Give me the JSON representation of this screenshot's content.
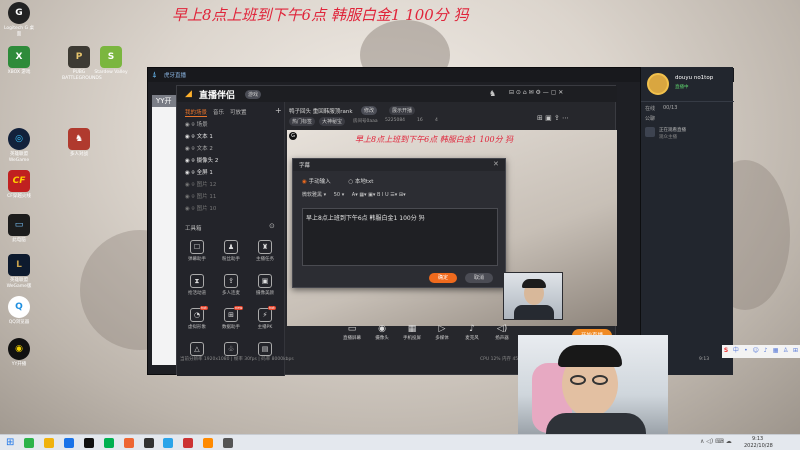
{
  "overlay_title": "早上8点上班到下午6点 韩服白金1 100分 犸",
  "desktop_icons": [
    {
      "name": "Logitech G HUB",
      "label": "Logitech G\n桌面"
    },
    {
      "name": "xbox-game",
      "label": "XBOX\n游戏"
    },
    {
      "name": "pubg",
      "label": "PUBG\nBATTLEGROUNDS"
    },
    {
      "name": "stardew",
      "label": "Stardew\nValley"
    },
    {
      "name": "dota-net",
      "label": "英雄联盟\nWeGame"
    },
    {
      "name": "anti-cheat",
      "label": "多人对战"
    },
    {
      "name": "crossfire",
      "label": "CF穿越火线"
    },
    {
      "name": "computer",
      "label": "此电脑"
    },
    {
      "name": "lol",
      "label": "英雄联盟\nWeGame版"
    },
    {
      "name": "qqbrowser",
      "label": "QQ浏览器"
    },
    {
      "name": "yy",
      "label": "YY开播"
    }
  ],
  "yy_window": {
    "brand": "虎牙直播",
    "tab_label": "YY开"
  },
  "live_app": {
    "title": "直播伴侣",
    "version_badge": "游戏",
    "stream_title": "鸭子回头 重回韩服顶rank",
    "change_label": "修改",
    "announce_label": "展示开播",
    "category": "英雄联盟",
    "tags": [
      "热门标签",
      "大神秘宝"
    ],
    "room_stats": "房间号0aaa",
    "viewers": "5225084",
    "likes": "16",
    "fans": "4",
    "left_tabs": [
      "我的场景",
      "音乐",
      "可放置"
    ],
    "scenes": [
      {
        "label": "场景",
        "selected": false
      },
      {
        "label": "文本 1",
        "selected": true
      },
      {
        "label": "文本 2",
        "selected": false
      },
      {
        "label": "摄像头 2",
        "selected": true
      },
      {
        "label": "全屏 1",
        "selected": true
      },
      {
        "label": "图片 12",
        "selected": false
      },
      {
        "label": "图片 11",
        "selected": false
      },
      {
        "label": "图片 10",
        "selected": false
      }
    ],
    "tools_label": "工具箱",
    "tools": [
      {
        "icon": "☐",
        "label": "弹幕助手"
      },
      {
        "icon": "♟",
        "label": "粉丝助手"
      },
      {
        "icon": "♜",
        "label": "主播任务"
      },
      {
        "icon": "⧗",
        "label": "抢活动道"
      },
      {
        "icon": "⇪",
        "label": "多人连麦"
      },
      {
        "icon": "▣",
        "label": "摄像美颜"
      },
      {
        "icon": "◔",
        "label": "虚拟形象",
        "hot": "hot"
      },
      {
        "icon": "⊞",
        "label": "数据助手",
        "hot": "new"
      },
      {
        "icon": "⚡",
        "label": "主播PK",
        "hot": "hot"
      },
      {
        "icon": "△",
        "label": "更多"
      },
      {
        "icon": "♧",
        "label": "直播间"
      },
      {
        "icon": "▤",
        "label": "工具"
      }
    ],
    "preview_overlay": "早上8点上班到下午6点 韩服白金1 100分 犸",
    "bottom_tools": [
      {
        "icon": "▭",
        "label": "直播屏幕"
      },
      {
        "icon": "◉",
        "label": "摄像头"
      },
      {
        "icon": "▦",
        "label": "手机投屏"
      },
      {
        "icon": "▷",
        "label": "多媒体"
      },
      {
        "icon": "♪",
        "label": "麦克风"
      },
      {
        "icon": "◁)",
        "label": "扬声器"
      }
    ],
    "start_live": "开始直播",
    "status_bar": "当前分辨率 1920x1080 | 帧率 30fps | 码率 8000kbps",
    "status_right": "CPU 12% 内存 45%"
  },
  "subtitle_dialog": {
    "title": "字幕",
    "mode_manual": "手动输入",
    "mode_file": "本地txt",
    "font_name": "微软雅黑",
    "font_size": "50",
    "text_value": "早上8点上班到下午6点 韩服白金1 100分 犸",
    "ok_label": "确定",
    "cancel_label": "取消"
  },
  "chat_panel": {
    "username": "douyu no1top",
    "status": "直播中",
    "online_label": "在线",
    "online_count": "00/13",
    "chat_tab": "公聊",
    "chat_entry": "正在观看直播",
    "chat_entry2": "观众主播",
    "time": "9:13",
    "date": "2022/10/28"
  },
  "taskbar": {
    "time": "9:13",
    "date": "2022/10/28"
  },
  "colors": {
    "accent_orange": "#ef6a1d",
    "overlay_red": "#e0243a"
  }
}
